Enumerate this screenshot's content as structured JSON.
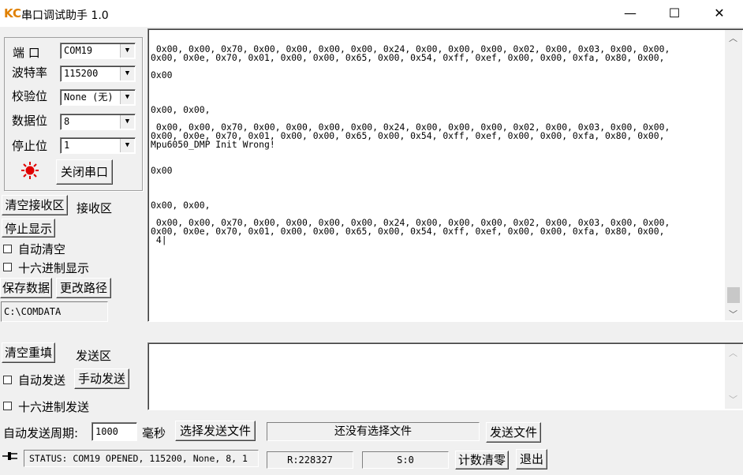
{
  "window": {
    "title": "串口调试助手 1.0",
    "icon_text": "KC",
    "minimize": "—",
    "maximize": "☐",
    "close": "✕"
  },
  "settings": {
    "port_label": "端  口",
    "port_value": "COM19",
    "baud_label": "波特率",
    "baud_value": "115200",
    "parity_label": "校验位",
    "parity_value": "None (无)",
    "databits_label": "数据位",
    "databits_value": "8",
    "stopbits_label": "停止位",
    "stopbits_value": "1",
    "close_port_button": "关闭串口",
    "status_led_color": "#e00000"
  },
  "receive": {
    "clear_button": "清空接收区",
    "area_label": "接收区",
    "stop_display_button": "停止显示",
    "auto_clear_label": "自动清空",
    "hex_display_label": "十六进制显示",
    "save_data_button": "保存数据",
    "change_path_button": "更改路径",
    "path_value": "C:\\COMDATA",
    "lines": [
      " 0x00, 0x00, 0x70, 0x00, 0x00, 0x00, 0x00, 0x24, 0x00, 0x00, 0x00, 0x02, 0x00, 0x03, 0x00, 0x00,",
      "0x00, 0x0e, 0x70, 0x01, 0x00, 0x00, 0x65, 0x00, 0x54, 0xff, 0xef, 0x00, 0x00, 0xfa, 0x80, 0x00,",
      "",
      "0x00",
      "",
      "",
      "",
      "0x00, 0x00,",
      "",
      " 0x00, 0x00, 0x70, 0x00, 0x00, 0x00, 0x00, 0x24, 0x00, 0x00, 0x00, 0x02, 0x00, 0x03, 0x00, 0x00,",
      "0x00, 0x0e, 0x70, 0x01, 0x00, 0x00, 0x65, 0x00, 0x54, 0xff, 0xef, 0x00, 0x00, 0xfa, 0x80, 0x00,",
      "Mpu6050_DMP Init Wrong!",
      "",
      "",
      "0x00",
      "",
      "",
      "",
      "0x00, 0x00,",
      "",
      " 0x00, 0x00, 0x70, 0x00, 0x00, 0x00, 0x00, 0x24, 0x00, 0x00, 0x00, 0x02, 0x00, 0x03, 0x00, 0x00,",
      "0x00, 0x0e, 0x70, 0x01, 0x00, 0x00, 0x65, 0x00, 0x54, 0xff, 0xef, 0x00, 0x00, 0xfa, 0x80, 0x00,",
      " 4|"
    ]
  },
  "send": {
    "clear_button": "清空重填",
    "area_label": "发送区",
    "auto_send_label": "自动发送",
    "manual_send_button": "手动发送",
    "hex_send_label": "十六进制发送",
    "period_label": "自动发送周期:",
    "period_value": "1000",
    "period_unit": "毫秒",
    "choose_file_button": "选择发送文件",
    "file_status": "还没有选择文件",
    "send_file_button": "发送文件",
    "text": ""
  },
  "status": {
    "icon": "plug-icon",
    "text": "STATUS: COM19 OPENED, 115200, None, 8, 1",
    "rx": "R:228327",
    "tx": "S:0",
    "reset_count_button": "计数清零",
    "exit_button": "退出"
  }
}
